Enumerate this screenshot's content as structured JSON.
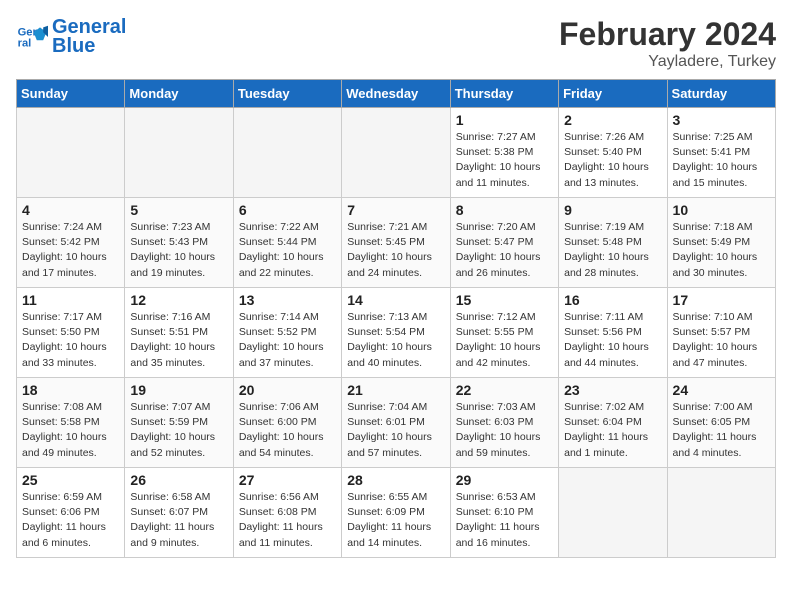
{
  "header": {
    "logo_line1": "General",
    "logo_line2": "Blue",
    "title": "February 2024",
    "subtitle": "Yayladere, Turkey"
  },
  "days_of_week": [
    "Sunday",
    "Monday",
    "Tuesday",
    "Wednesday",
    "Thursday",
    "Friday",
    "Saturday"
  ],
  "weeks": [
    [
      {
        "num": "",
        "info": "",
        "empty": true
      },
      {
        "num": "",
        "info": "",
        "empty": true
      },
      {
        "num": "",
        "info": "",
        "empty": true
      },
      {
        "num": "",
        "info": "",
        "empty": true
      },
      {
        "num": "1",
        "info": "Sunrise: 7:27 AM\nSunset: 5:38 PM\nDaylight: 10 hours\nand 11 minutes."
      },
      {
        "num": "2",
        "info": "Sunrise: 7:26 AM\nSunset: 5:40 PM\nDaylight: 10 hours\nand 13 minutes."
      },
      {
        "num": "3",
        "info": "Sunrise: 7:25 AM\nSunset: 5:41 PM\nDaylight: 10 hours\nand 15 minutes."
      }
    ],
    [
      {
        "num": "4",
        "info": "Sunrise: 7:24 AM\nSunset: 5:42 PM\nDaylight: 10 hours\nand 17 minutes."
      },
      {
        "num": "5",
        "info": "Sunrise: 7:23 AM\nSunset: 5:43 PM\nDaylight: 10 hours\nand 19 minutes."
      },
      {
        "num": "6",
        "info": "Sunrise: 7:22 AM\nSunset: 5:44 PM\nDaylight: 10 hours\nand 22 minutes."
      },
      {
        "num": "7",
        "info": "Sunrise: 7:21 AM\nSunset: 5:45 PM\nDaylight: 10 hours\nand 24 minutes."
      },
      {
        "num": "8",
        "info": "Sunrise: 7:20 AM\nSunset: 5:47 PM\nDaylight: 10 hours\nand 26 minutes."
      },
      {
        "num": "9",
        "info": "Sunrise: 7:19 AM\nSunset: 5:48 PM\nDaylight: 10 hours\nand 28 minutes."
      },
      {
        "num": "10",
        "info": "Sunrise: 7:18 AM\nSunset: 5:49 PM\nDaylight: 10 hours\nand 30 minutes."
      }
    ],
    [
      {
        "num": "11",
        "info": "Sunrise: 7:17 AM\nSunset: 5:50 PM\nDaylight: 10 hours\nand 33 minutes."
      },
      {
        "num": "12",
        "info": "Sunrise: 7:16 AM\nSunset: 5:51 PM\nDaylight: 10 hours\nand 35 minutes."
      },
      {
        "num": "13",
        "info": "Sunrise: 7:14 AM\nSunset: 5:52 PM\nDaylight: 10 hours\nand 37 minutes."
      },
      {
        "num": "14",
        "info": "Sunrise: 7:13 AM\nSunset: 5:54 PM\nDaylight: 10 hours\nand 40 minutes."
      },
      {
        "num": "15",
        "info": "Sunrise: 7:12 AM\nSunset: 5:55 PM\nDaylight: 10 hours\nand 42 minutes."
      },
      {
        "num": "16",
        "info": "Sunrise: 7:11 AM\nSunset: 5:56 PM\nDaylight: 10 hours\nand 44 minutes."
      },
      {
        "num": "17",
        "info": "Sunrise: 7:10 AM\nSunset: 5:57 PM\nDaylight: 10 hours\nand 47 minutes."
      }
    ],
    [
      {
        "num": "18",
        "info": "Sunrise: 7:08 AM\nSunset: 5:58 PM\nDaylight: 10 hours\nand 49 minutes."
      },
      {
        "num": "19",
        "info": "Sunrise: 7:07 AM\nSunset: 5:59 PM\nDaylight: 10 hours\nand 52 minutes."
      },
      {
        "num": "20",
        "info": "Sunrise: 7:06 AM\nSunset: 6:00 PM\nDaylight: 10 hours\nand 54 minutes."
      },
      {
        "num": "21",
        "info": "Sunrise: 7:04 AM\nSunset: 6:01 PM\nDaylight: 10 hours\nand 57 minutes."
      },
      {
        "num": "22",
        "info": "Sunrise: 7:03 AM\nSunset: 6:03 PM\nDaylight: 10 hours\nand 59 minutes."
      },
      {
        "num": "23",
        "info": "Sunrise: 7:02 AM\nSunset: 6:04 PM\nDaylight: 11 hours\nand 1 minute."
      },
      {
        "num": "24",
        "info": "Sunrise: 7:00 AM\nSunset: 6:05 PM\nDaylight: 11 hours\nand 4 minutes."
      }
    ],
    [
      {
        "num": "25",
        "info": "Sunrise: 6:59 AM\nSunset: 6:06 PM\nDaylight: 11 hours\nand 6 minutes."
      },
      {
        "num": "26",
        "info": "Sunrise: 6:58 AM\nSunset: 6:07 PM\nDaylight: 11 hours\nand 9 minutes."
      },
      {
        "num": "27",
        "info": "Sunrise: 6:56 AM\nSunset: 6:08 PM\nDaylight: 11 hours\nand 11 minutes."
      },
      {
        "num": "28",
        "info": "Sunrise: 6:55 AM\nSunset: 6:09 PM\nDaylight: 11 hours\nand 14 minutes."
      },
      {
        "num": "29",
        "info": "Sunrise: 6:53 AM\nSunset: 6:10 PM\nDaylight: 11 hours\nand 16 minutes."
      },
      {
        "num": "",
        "info": "",
        "empty": true
      },
      {
        "num": "",
        "info": "",
        "empty": true
      }
    ]
  ]
}
